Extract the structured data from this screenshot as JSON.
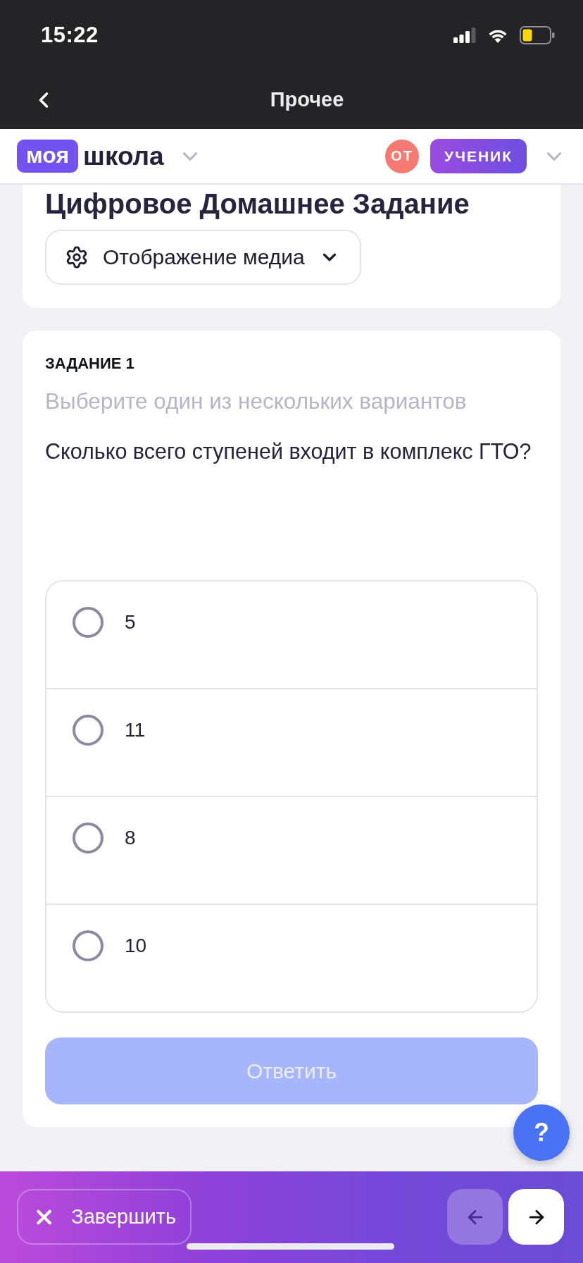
{
  "status_bar": {
    "time": "15:22"
  },
  "nav_bar": {
    "title": "Прочее"
  },
  "header": {
    "logo_badge": "моя",
    "logo_text": "школа",
    "avatar_initials": "ОТ",
    "role": "УЧЕНИК"
  },
  "homework": {
    "title": "Цифровое Домашнее Задание",
    "media_button": "Отображение медиа"
  },
  "task": {
    "heading": "ЗАДАНИЕ 1",
    "instruction": "Выберите один из нескольких вариантов",
    "question": "Сколько всего ступеней входит в комплекс ГТО?",
    "options": [
      {
        "label": "5",
        "selected": false
      },
      {
        "label": "11",
        "selected": false
      },
      {
        "label": "8",
        "selected": false
      },
      {
        "label": "10",
        "selected": false
      }
    ],
    "submit": {
      "label": "Ответить",
      "disabled": true
    }
  },
  "help_button": {
    "label": "?"
  },
  "bottom_bar": {
    "finish_button": "Завершить",
    "nav_buttons": [
      {
        "kind": "prev",
        "disabled": true
      },
      {
        "kind": "next",
        "disabled": false
      }
    ]
  }
}
